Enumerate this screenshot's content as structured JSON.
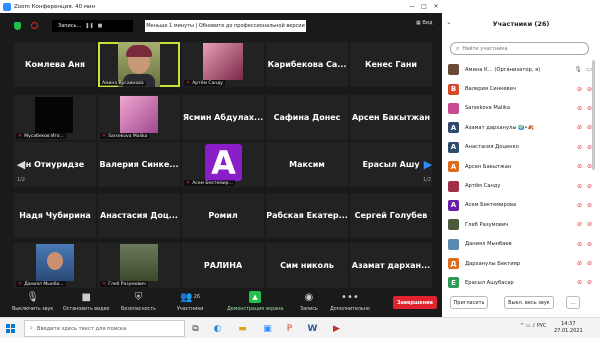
{
  "window": {
    "title": "Zoom Конференция. 40 мин",
    "controls": [
      "—",
      "□",
      "✕"
    ]
  },
  "meeting": {
    "recording_label": "Запись...",
    "notice": "Меньше 1 минуты | Обновите до профессиональной версии",
    "view_label": "Вид"
  },
  "grid": {
    "page_left": "1/2",
    "page_right": "1/2",
    "tiles": [
      {
        "name": "Комлева Аня",
        "caption": "",
        "mic_off": false,
        "kind": "text"
      },
      {
        "name": "",
        "caption": "Амина Кусаинова",
        "mic_off": false,
        "kind": "video",
        "active": true
      },
      {
        "name": "",
        "caption": "Артём Санду",
        "mic_off": true,
        "kind": "anime"
      },
      {
        "name": "Карибекова Са...",
        "caption": "",
        "mic_off": false,
        "kind": "text"
      },
      {
        "name": "Кенес Гани",
        "caption": "",
        "mic_off": false,
        "kind": "text"
      },
      {
        "name": "",
        "caption": "Мусабеков Иго...",
        "mic_off": true,
        "kind": "black"
      },
      {
        "name": "",
        "caption": "Sarsekova Malika",
        "mic_off": true,
        "kind": "pink"
      },
      {
        "name": "Ясмин Абдулах...",
        "caption": "",
        "mic_off": false,
        "kind": "text"
      },
      {
        "name": "Сафина Донес",
        "caption": "",
        "mic_off": false,
        "kind": "text"
      },
      {
        "name": "Арсен Бакытжан",
        "caption": "",
        "mic_off": false,
        "kind": "text"
      },
      {
        "name": "н Отиуридзе",
        "caption": "",
        "mic_off": false,
        "kind": "text"
      },
      {
        "name": "Валерия Синке...",
        "caption": "",
        "mic_off": false,
        "kind": "text"
      },
      {
        "name": "",
        "caption": "Асем Бектемир...",
        "mic_off": true,
        "kind": "letter",
        "letter": "A"
      },
      {
        "name": "Максим",
        "caption": "",
        "mic_off": false,
        "kind": "text"
      },
      {
        "name": "Ерасыл Ашу",
        "caption": "",
        "mic_off": false,
        "kind": "text"
      },
      {
        "name": "Надя Чубирина",
        "caption": "",
        "mic_off": false,
        "kind": "text"
      },
      {
        "name": "Анастасия Доц...",
        "caption": "",
        "mic_off": false,
        "kind": "text"
      },
      {
        "name": "Ромил",
        "caption": "",
        "mic_off": false,
        "kind": "text"
      },
      {
        "name": "Рабская Екатер...",
        "caption": "",
        "mic_off": false,
        "kind": "text"
      },
      {
        "name": "Сергей Голубев",
        "caption": "",
        "mic_off": false,
        "kind": "text"
      },
      {
        "name": "",
        "caption": "Даниял Мынба...",
        "mic_off": true,
        "kind": "boy"
      },
      {
        "name": "",
        "caption": "Глеб Разумович",
        "mic_off": true,
        "kind": "outdoor"
      },
      {
        "name": "РАЛИНА",
        "caption": "",
        "mic_off": false,
        "kind": "text"
      },
      {
        "name": "Сим николь",
        "caption": "",
        "mic_off": false,
        "kind": "text"
      },
      {
        "name": "Азамат дархан...",
        "caption": "",
        "mic_off": false,
        "kind": "text"
      }
    ]
  },
  "toolbar": {
    "mute": "Выключить звук",
    "video": "Остановить видео",
    "security": "Безопасность",
    "participants": "Участники",
    "participants_count": "26",
    "share": "Демонстрация экрана",
    "record": "Запись",
    "more": "Дополнительно",
    "end": "Завершение"
  },
  "panel": {
    "title": "Участники (26)",
    "search_placeholder": "Найти участника",
    "invite": "Пригласить",
    "mute_all": "Выкл. весь звук",
    "more": "...",
    "participants": [
      {
        "name": "Амина К... (Организатор, я)",
        "initial": "",
        "color": "#6b4a3a",
        "mic_off": false,
        "cam_off": false
      },
      {
        "name": "Валерия Синкевич",
        "initial": "В",
        "color": "#d9482b",
        "mic_off": true,
        "cam_off": true
      },
      {
        "name": "Sarsekova Malika",
        "initial": "",
        "color": "#c84a90",
        "mic_off": true,
        "cam_off": true
      },
      {
        "name": "Азамат дарханулы 🌍•🍂",
        "initial": "А",
        "color": "#2f4a6d",
        "mic_off": true,
        "cam_off": true
      },
      {
        "name": "Анастасия Доценко",
        "initial": "А",
        "color": "#2f4a6d",
        "mic_off": true,
        "cam_off": true
      },
      {
        "name": "Арсен Бакытжан",
        "initial": "А",
        "color": "#e06a1c",
        "mic_off": true,
        "cam_off": true
      },
      {
        "name": "Артём Санду",
        "initial": "",
        "color": "#a03048",
        "mic_off": true,
        "cam_off": true
      },
      {
        "name": "Асем Бектемирова",
        "initial": "A",
        "color": "#6a1ea8",
        "mic_off": true,
        "cam_off": true
      },
      {
        "name": "Глеб Разумович",
        "initial": "",
        "color": "#4a5a3a",
        "mic_off": true,
        "cam_off": true
      },
      {
        "name": "Даниял Мынбаев",
        "initial": "",
        "color": "#5a8ab0",
        "mic_off": true,
        "cam_off": true
      },
      {
        "name": "Дарханулы Бектияр",
        "initial": "Д",
        "color": "#e06a1c",
        "mic_off": true,
        "cam_off": true
      },
      {
        "name": "Ерасыл Ашубасар",
        "initial": "Е",
        "color": "#2e9a5a",
        "mic_off": true,
        "cam_off": true
      }
    ]
  },
  "taskbar": {
    "search_text": "Введите здесь текст для поиска",
    "lang": "РУС",
    "time": "14:37",
    "date": "27.01.2021"
  },
  "colors": {
    "accent": "#2d8cff",
    "end": "#e0232e",
    "active_border": "#c8e23a",
    "share": "#20c04a"
  }
}
